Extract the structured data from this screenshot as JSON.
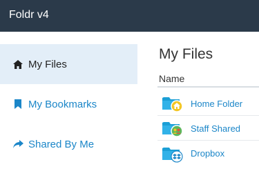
{
  "app": {
    "title": "Foldr v4"
  },
  "sidebar": {
    "items": [
      {
        "label": "My Files",
        "icon": "home-icon",
        "active": true
      },
      {
        "label": "My Bookmarks",
        "icon": "bookmark-icon",
        "active": false
      },
      {
        "label": "Shared By Me",
        "icon": "share-icon",
        "active": false
      }
    ]
  },
  "main": {
    "title": "My Files",
    "column_header": "Name",
    "files": [
      {
        "name": "Home Folder",
        "icon": "home-folder-icon"
      },
      {
        "name": "Staff Shared",
        "icon": "shared-folder-icon"
      },
      {
        "name": "Dropbox",
        "icon": "dropbox-folder-icon"
      }
    ]
  },
  "colors": {
    "header_bg": "#2b3a4a",
    "link": "#1b86c8",
    "active_bg": "#e3eef8",
    "folder": "#1b9fd6"
  }
}
